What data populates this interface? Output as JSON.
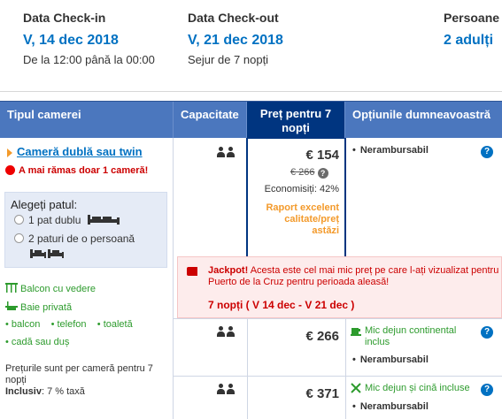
{
  "header": {
    "checkin": {
      "label": "Data Check-in",
      "date": "V, 14 dec 2018",
      "sub": "De la 12:00 până la 00:00"
    },
    "checkout": {
      "label": "Data Check-out",
      "date": "V, 21 dec 2018",
      "sub": "Sejur de 7 nopți"
    },
    "guests": {
      "label": "Persoane",
      "value": "2 adulți"
    }
  },
  "table": {
    "columns": [
      "Tipul camerei",
      "Capacitate",
      "Preț pentru 7 nopți",
      "Opțiunile dumneavoastră"
    ],
    "room": {
      "name": "Cameră dublă sau twin",
      "scarcity": "A mai rămas doar 1 cameră!",
      "bed_title": "Alegeți patul:",
      "bed_options": [
        "1 pat dublu",
        "2 paturi de o persoană"
      ],
      "amenities": [
        "Balcon cu vedere",
        "Baie privată"
      ],
      "features": [
        "balcon",
        "telefon",
        "toaletă",
        "cadă sau duș"
      ],
      "foot_note": "Prețurile sunt per cameră pentru 7 nopți",
      "inclusive_label": "Inclusiv",
      "inclusive_value": ": 7 % taxă"
    },
    "rows": [
      {
        "price": "€ 154",
        "old_price": "€ 266",
        "savings": "Economisiți: 42%",
        "rating": "Raport excelent calitate/preț astăzi",
        "options": [
          {
            "text": "Nerambursabil",
            "type": "bold"
          }
        ]
      },
      {
        "price": "€ 266",
        "options": [
          {
            "text": "Mic dejun continental inclus",
            "type": "meal"
          },
          {
            "text": "Nerambursabil",
            "type": "bold"
          }
        ]
      },
      {
        "price": "€ 371",
        "options": [
          {
            "text": "Mic dejun și cină incluse",
            "type": "meal"
          },
          {
            "text": "Nerambursabil",
            "type": "bold"
          }
        ]
      }
    ]
  },
  "jackpot": {
    "label": "Jackpot!",
    "text": " Acesta este cel mai mic preț pe care l-ați vizualizat pentru Puerto de la Cruz pentru perioada aleasă!",
    "dates": "7 nopți ( V 14 dec - V 21 dec )"
  },
  "icons": {
    "info": "i",
    "help": "?"
  },
  "colors": {
    "link_blue": "#0071c2",
    "header_blue": "#4b77be",
    "selected_blue": "#003580",
    "alert_red": "#cc0000",
    "green": "#2d9b2d",
    "orange": "#f39a2b"
  }
}
